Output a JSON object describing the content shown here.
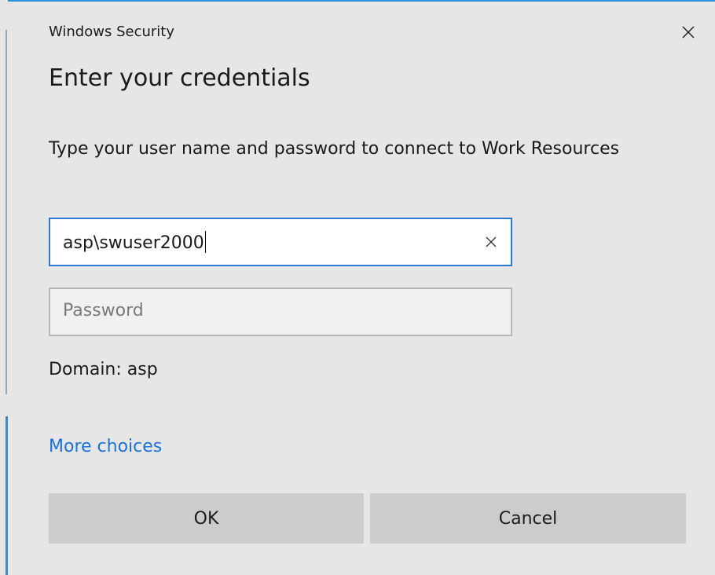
{
  "window": {
    "app_title": "Windows Security",
    "close_icon": "close-icon"
  },
  "dialog": {
    "heading": "Enter your credentials",
    "message": "Type your user name and password to connect to Work Resources"
  },
  "username": {
    "value": "asp\\swuser2000",
    "clear_icon": "clear-icon"
  },
  "password": {
    "placeholder": "Password",
    "value": ""
  },
  "domain_text": "Domain: asp",
  "more_choices_label": "More choices",
  "buttons": {
    "ok_label": "OK",
    "cancel_label": "Cancel"
  },
  "colors": {
    "accent": "#2b7bd3",
    "link": "#1a73d9",
    "background": "#e6e6e6",
    "button": "#cccccc"
  }
}
